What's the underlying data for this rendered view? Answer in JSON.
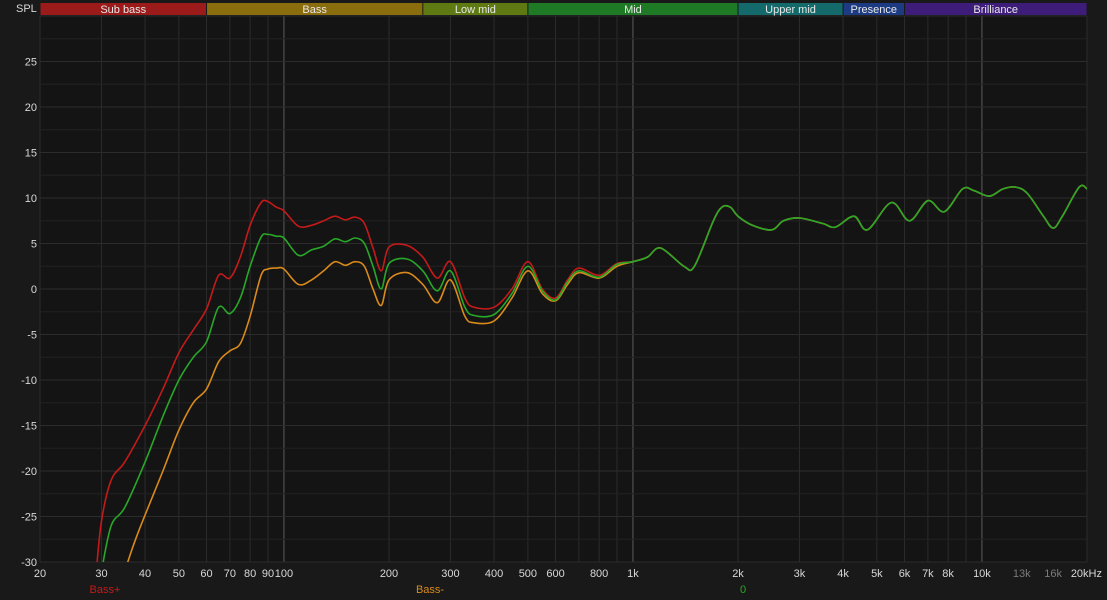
{
  "chart_data": {
    "type": "line",
    "ylabel": "SPL",
    "xscale": "log",
    "xlim": [
      20,
      20000
    ],
    "ylim": [
      -30,
      30
    ],
    "grid": true,
    "bands": [
      {
        "name": "Sub bass",
        "from": 20,
        "to": 60,
        "color": "#9b1b1b"
      },
      {
        "name": "Bass",
        "from": 60,
        "to": 250,
        "color": "#8a6d0d"
      },
      {
        "name": "Low mid",
        "from": 250,
        "to": 500,
        "color": "#5f7a12"
      },
      {
        "name": "Mid",
        "from": 500,
        "to": 2000,
        "color": "#1f7a25"
      },
      {
        "name": "Upper mid",
        "from": 2000,
        "to": 4000,
        "color": "#146a6a"
      },
      {
        "name": "Presence",
        "from": 4000,
        "to": 6000,
        "color": "#1c3b82"
      },
      {
        "name": "Brilliance",
        "from": 6000,
        "to": 20000,
        "color": "#3e1d7a"
      }
    ],
    "x_ticks": [
      {
        "v": 20,
        "label": "20"
      },
      {
        "v": 30,
        "label": "30"
      },
      {
        "v": 40,
        "label": "40"
      },
      {
        "v": 50,
        "label": "50"
      },
      {
        "v": 60,
        "label": "60"
      },
      {
        "v": 70,
        "label": "70"
      },
      {
        "v": 80,
        "label": "80"
      },
      {
        "v": 90,
        "label": "90"
      },
      {
        "v": 100,
        "label": "100"
      },
      {
        "v": 200,
        "label": "200"
      },
      {
        "v": 300,
        "label": "300"
      },
      {
        "v": 400,
        "label": "400"
      },
      {
        "v": 500,
        "label": "500"
      },
      {
        "v": 600,
        "label": "600"
      },
      {
        "v": 800,
        "label": "800"
      },
      {
        "v": 1000,
        "label": "1k"
      },
      {
        "v": 2000,
        "label": "2k"
      },
      {
        "v": 3000,
        "label": "3k"
      },
      {
        "v": 4000,
        "label": "4k"
      },
      {
        "v": 5000,
        "label": "5k"
      },
      {
        "v": 6000,
        "label": "6k"
      },
      {
        "v": 7000,
        "label": "7k"
      },
      {
        "v": 8000,
        "label": "8k"
      },
      {
        "v": 10000,
        "label": "10k"
      },
      {
        "v": 13000,
        "label": "13k",
        "dim": true
      },
      {
        "v": 16000,
        "label": "16k",
        "dim": true
      },
      {
        "v": 20000,
        "label": "20kHz"
      }
    ],
    "y_ticks": [
      {
        "v": 25,
        "label": "25"
      },
      {
        "v": 20,
        "label": "20"
      },
      {
        "v": 15,
        "label": "15"
      },
      {
        "v": 10,
        "label": "10"
      },
      {
        "v": 5,
        "label": "5"
      },
      {
        "v": 0,
        "label": "0"
      },
      {
        "v": -5,
        "label": "-5"
      },
      {
        "v": -10,
        "label": "-10"
      },
      {
        "v": -15,
        "label": "-15"
      },
      {
        "v": -20,
        "label": "-20"
      },
      {
        "v": -25,
        "label": "-25"
      },
      {
        "v": -30,
        "label": "-30"
      }
    ],
    "series": [
      {
        "name": "Bass+",
        "color": "#c41a1a",
        "points": [
          [
            29,
            -31
          ],
          [
            30,
            -25.5
          ],
          [
            32,
            -21
          ],
          [
            35,
            -19
          ],
          [
            40,
            -15
          ],
          [
            45,
            -11
          ],
          [
            50,
            -7
          ],
          [
            55,
            -4.5
          ],
          [
            60,
            -2.2
          ],
          [
            65,
            1.5
          ],
          [
            70,
            1.2
          ],
          [
            75,
            3.5
          ],
          [
            80,
            7
          ],
          [
            86,
            9.5
          ],
          [
            90,
            9.6
          ],
          [
            95,
            9
          ],
          [
            100,
            8.6
          ],
          [
            110,
            6.9
          ],
          [
            120,
            7
          ],
          [
            130,
            7.5
          ],
          [
            140,
            8
          ],
          [
            150,
            7.6
          ],
          [
            160,
            7.9
          ],
          [
            170,
            7.2
          ],
          [
            180,
            4.5
          ],
          [
            190,
            2
          ],
          [
            200,
            4.6
          ],
          [
            225,
            4.8
          ],
          [
            250,
            3.5
          ],
          [
            275,
            1.2
          ],
          [
            300,
            3
          ],
          [
            330,
            -1
          ],
          [
            350,
            -2
          ],
          [
            400,
            -2
          ],
          [
            450,
            0
          ],
          [
            500,
            3
          ],
          [
            550,
            0
          ],
          [
            600,
            -1
          ],
          [
            650,
            1
          ],
          [
            700,
            2.3
          ],
          [
            800,
            1.5
          ],
          [
            900,
            2.8
          ],
          [
            1000,
            3
          ],
          [
            1100,
            3.5
          ],
          [
            1200,
            4.5
          ],
          [
            1400,
            2.5
          ],
          [
            1500,
            2.5
          ],
          [
            1700,
            7.5
          ],
          [
            1800,
            9
          ],
          [
            1900,
            9
          ],
          [
            2000,
            8
          ],
          [
            2200,
            7
          ],
          [
            2500,
            6.5
          ],
          [
            2700,
            7.5
          ],
          [
            3000,
            7.8
          ],
          [
            3500,
            7.2
          ],
          [
            3800,
            6.8
          ],
          [
            4300,
            8
          ],
          [
            4700,
            6.5
          ],
          [
            5500,
            9.5
          ],
          [
            6200,
            7.5
          ],
          [
            7000,
            9.7
          ],
          [
            7800,
            8.5
          ],
          [
            8800,
            11
          ],
          [
            9500,
            10.8
          ],
          [
            10500,
            10.2
          ],
          [
            11500,
            11
          ],
          [
            12500,
            11.2
          ],
          [
            13500,
            10.5
          ],
          [
            15000,
            8
          ],
          [
            16000,
            6.7
          ],
          [
            17000,
            8
          ],
          [
            19000,
            11.2
          ],
          [
            20000,
            11
          ]
        ]
      },
      {
        "name": "Bass-",
        "color": "#d98a1a",
        "points": [
          [
            35,
            -31
          ],
          [
            38,
            -27
          ],
          [
            45,
            -20
          ],
          [
            50,
            -15.5
          ],
          [
            55,
            -12.5
          ],
          [
            60,
            -11
          ],
          [
            65,
            -8
          ],
          [
            70,
            -6.8
          ],
          [
            75,
            -6
          ],
          [
            80,
            -3
          ],
          [
            86,
            1.5
          ],
          [
            90,
            2.2
          ],
          [
            95,
            2.3
          ],
          [
            100,
            2.2
          ],
          [
            110,
            0.5
          ],
          [
            120,
            1
          ],
          [
            130,
            2
          ],
          [
            140,
            3
          ],
          [
            150,
            2.6
          ],
          [
            160,
            3
          ],
          [
            170,
            2.5
          ],
          [
            180,
            0
          ],
          [
            190,
            -1.8
          ],
          [
            200,
            1
          ],
          [
            225,
            1.8
          ],
          [
            250,
            0.5
          ],
          [
            275,
            -1.5
          ],
          [
            300,
            1
          ],
          [
            330,
            -3
          ],
          [
            350,
            -3.7
          ],
          [
            400,
            -3.5
          ],
          [
            450,
            -1
          ],
          [
            500,
            2
          ],
          [
            550,
            -0.5
          ],
          [
            600,
            -1.3
          ],
          [
            650,
            0.5
          ],
          [
            700,
            1.8
          ],
          [
            800,
            1.2
          ],
          [
            900,
            2.5
          ],
          [
            1000,
            3
          ],
          [
            1100,
            3.5
          ],
          [
            1200,
            4.5
          ],
          [
            1400,
            2.5
          ],
          [
            1500,
            2.5
          ],
          [
            1700,
            7.5
          ],
          [
            1800,
            9
          ],
          [
            1900,
            9
          ],
          [
            2000,
            8
          ],
          [
            2200,
            7
          ],
          [
            2500,
            6.5
          ],
          [
            2700,
            7.5
          ],
          [
            3000,
            7.8
          ],
          [
            3500,
            7.2
          ],
          [
            3800,
            6.8
          ],
          [
            4300,
            8
          ],
          [
            4700,
            6.5
          ],
          [
            5500,
            9.5
          ],
          [
            6200,
            7.5
          ],
          [
            7000,
            9.7
          ],
          [
            7800,
            8.5
          ],
          [
            8800,
            11
          ],
          [
            9500,
            10.8
          ],
          [
            10500,
            10.2
          ],
          [
            11500,
            11
          ],
          [
            12500,
            11.2
          ],
          [
            13500,
            10.5
          ],
          [
            15000,
            8
          ],
          [
            16000,
            6.7
          ],
          [
            17000,
            8
          ],
          [
            19000,
            11.2
          ],
          [
            20000,
            11
          ]
        ]
      },
      {
        "name": "0",
        "color": "#28a828",
        "points": [
          [
            30,
            -31
          ],
          [
            32,
            -26
          ],
          [
            35,
            -24
          ],
          [
            40,
            -19
          ],
          [
            45,
            -14
          ],
          [
            50,
            -10
          ],
          [
            55,
            -7.5
          ],
          [
            60,
            -5.8
          ],
          [
            65,
            -2
          ],
          [
            70,
            -2.7
          ],
          [
            75,
            -1
          ],
          [
            80,
            2.5
          ],
          [
            86,
            5.7
          ],
          [
            90,
            6
          ],
          [
            95,
            5.8
          ],
          [
            100,
            5.6
          ],
          [
            110,
            3.7
          ],
          [
            120,
            4.3
          ],
          [
            130,
            4.7
          ],
          [
            140,
            5.5
          ],
          [
            150,
            5.2
          ],
          [
            160,
            5.6
          ],
          [
            170,
            5
          ],
          [
            180,
            2.5
          ],
          [
            190,
            0
          ],
          [
            200,
            2.8
          ],
          [
            225,
            3.3
          ],
          [
            250,
            2
          ],
          [
            275,
            -0.2
          ],
          [
            300,
            2
          ],
          [
            330,
            -2
          ],
          [
            350,
            -2.9
          ],
          [
            400,
            -2.8
          ],
          [
            450,
            -0.5
          ],
          [
            500,
            2.5
          ],
          [
            550,
            -0.2
          ],
          [
            600,
            -1.2
          ],
          [
            650,
            0.8
          ],
          [
            700,
            2
          ],
          [
            800,
            1.3
          ],
          [
            900,
            2.7
          ],
          [
            1000,
            3
          ],
          [
            1100,
            3.5
          ],
          [
            1200,
            4.5
          ],
          [
            1400,
            2.5
          ],
          [
            1500,
            2.5
          ],
          [
            1700,
            7.5
          ],
          [
            1800,
            9
          ],
          [
            1900,
            9
          ],
          [
            2000,
            8
          ],
          [
            2200,
            7
          ],
          [
            2500,
            6.5
          ],
          [
            2700,
            7.5
          ],
          [
            3000,
            7.8
          ],
          [
            3500,
            7.2
          ],
          [
            3800,
            6.8
          ],
          [
            4300,
            8
          ],
          [
            4700,
            6.5
          ],
          [
            5500,
            9.5
          ],
          [
            6200,
            7.5
          ],
          [
            7000,
            9.7
          ],
          [
            7800,
            8.5
          ],
          [
            8800,
            11
          ],
          [
            9500,
            10.8
          ],
          [
            10500,
            10.2
          ],
          [
            11500,
            11
          ],
          [
            12500,
            11.2
          ],
          [
            13500,
            10.5
          ],
          [
            15000,
            8
          ],
          [
            16000,
            6.7
          ],
          [
            17000,
            8
          ],
          [
            19000,
            11.2
          ],
          [
            20000,
            11
          ]
        ]
      }
    ]
  }
}
